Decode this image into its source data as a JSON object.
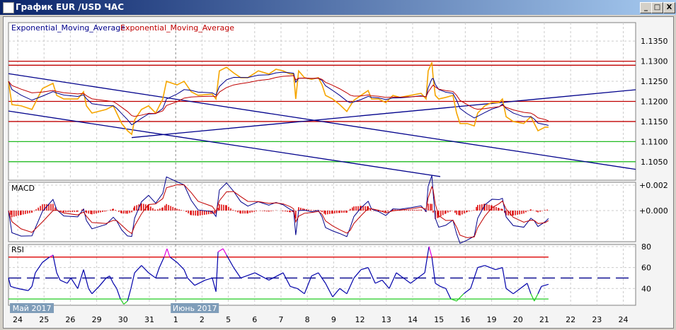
{
  "window": {
    "title": "График EUR /USD  ЧАС",
    "minimize": "_",
    "maximize": "□",
    "close": "X"
  },
  "legend": {
    "ema_fast": "Exponential_Moving_Average",
    "ema_slow": "Exponential_Moving_Average"
  },
  "colors": {
    "price": "#f5a500",
    "ema_fast": "#00008b",
    "ema_slow": "#c00000",
    "resistance": "#c00000",
    "support": "#22bb22",
    "trend": "#00008b",
    "macd_hist": "#dd0000",
    "rsi": "#0000aa",
    "rsi_over": "#dd00dd",
    "rsi_under": "#22cc22"
  },
  "chart_data": [
    {
      "type": "line",
      "panel": "price",
      "y_ticks": [
        "1.1350",
        "1.1300",
        "1.1250",
        "1.1200",
        "1.1150",
        "1.1100",
        "1.1050"
      ],
      "ylim": [
        1.1004,
        1.1396
      ],
      "x_ticks": [
        "24",
        "25",
        "26",
        "29",
        "30",
        "31",
        "1",
        "2",
        "5",
        "6",
        "7",
        "8",
        "9",
        "12",
        "13",
        "14",
        "15",
        "16",
        "19",
        "20",
        "21",
        "22",
        "23",
        "24"
      ],
      "month_labels": [
        {
          "label": "Май 2017",
          "tick": 0
        },
        {
          "label": "Июнь 2017",
          "tick": 6
        }
      ],
      "xlim": [
        -0.35,
        23.47
      ],
      "grid": true,
      "price_series": [
        [
          -0.35,
          1.125
        ],
        [
          -0.22,
          1.1192
        ],
        [
          0.13,
          1.1189
        ],
        [
          0.54,
          1.118
        ],
        [
          0.94,
          1.1232
        ],
        [
          1.34,
          1.1245
        ],
        [
          1.48,
          1.1215
        ],
        [
          1.75,
          1.1206
        ],
        [
          2.28,
          1.1206
        ],
        [
          2.5,
          1.1224
        ],
        [
          2.61,
          1.1189
        ],
        [
          2.82,
          1.1171
        ],
        [
          3.36,
          1.118
        ],
        [
          3.63,
          1.1189
        ],
        [
          3.76,
          1.1171
        ],
        [
          3.95,
          1.1145
        ],
        [
          4.17,
          1.1127
        ],
        [
          4.33,
          1.1118
        ],
        [
          4.44,
          1.1154
        ],
        [
          4.7,
          1.118
        ],
        [
          4.97,
          1.1189
        ],
        [
          5.24,
          1.1171
        ],
        [
          5.51,
          1.1206
        ],
        [
          5.65,
          1.125
        ],
        [
          6.05,
          1.1241
        ],
        [
          6.32,
          1.125
        ],
        [
          6.59,
          1.1224
        ],
        [
          6.85,
          1.1215
        ],
        [
          7.39,
          1.1218
        ],
        [
          7.53,
          1.1206
        ],
        [
          7.66,
          1.1276
        ],
        [
          7.93,
          1.1285
        ],
        [
          8.2,
          1.1271
        ],
        [
          8.47,
          1.1259
        ],
        [
          8.74,
          1.1259
        ],
        [
          9.14,
          1.1276
        ],
        [
          9.54,
          1.1268
        ],
        [
          9.81,
          1.128
        ],
        [
          10.08,
          1.1276
        ],
        [
          10.35,
          1.1268
        ],
        [
          10.48,
          1.1268
        ],
        [
          10.56,
          1.1206
        ],
        [
          10.67,
          1.1276
        ],
        [
          10.89,
          1.1259
        ],
        [
          11.16,
          1.1255
        ],
        [
          11.42,
          1.1259
        ],
        [
          11.56,
          1.1241
        ],
        [
          11.69,
          1.1215
        ],
        [
          11.96,
          1.1206
        ],
        [
          12.23,
          1.1192
        ],
        [
          12.5,
          1.1175
        ],
        [
          12.63,
          1.1189
        ],
        [
          12.77,
          1.1203
        ],
        [
          13.04,
          1.1215
        ],
        [
          13.31,
          1.1227
        ],
        [
          13.44,
          1.1206
        ],
        [
          13.71,
          1.1206
        ],
        [
          13.98,
          1.1197
        ],
        [
          14.25,
          1.1215
        ],
        [
          14.52,
          1.121
        ],
        [
          14.92,
          1.1215
        ],
        [
          15.32,
          1.122
        ],
        [
          15.51,
          1.1206
        ],
        [
          15.59,
          1.1276
        ],
        [
          15.73,
          1.1297
        ],
        [
          15.78,
          1.1259
        ],
        [
          15.86,
          1.1215
        ],
        [
          15.99,
          1.1206
        ],
        [
          16.26,
          1.121
        ],
        [
          16.53,
          1.1215
        ],
        [
          16.67,
          1.1171
        ],
        [
          16.8,
          1.1145
        ],
        [
          17.07,
          1.1145
        ],
        [
          17.34,
          1.1139
        ],
        [
          17.47,
          1.1171
        ],
        [
          17.74,
          1.1189
        ],
        [
          18.01,
          1.1197
        ],
        [
          18.28,
          1.1197
        ],
        [
          18.41,
          1.1206
        ],
        [
          18.55,
          1.1162
        ],
        [
          18.82,
          1.115
        ],
        [
          19.22,
          1.1145
        ],
        [
          19.49,
          1.1162
        ],
        [
          19.62,
          1.1145
        ],
        [
          19.76,
          1.1127
        ],
        [
          20.03,
          1.1136
        ],
        [
          20.16,
          1.1136
        ]
      ],
      "horizontal_levels": [
        {
          "price": 1.13,
          "kind": "resistance"
        },
        {
          "price": 1.129,
          "kind": "resistance"
        },
        {
          "price": 1.12,
          "kind": "resistance"
        },
        {
          "price": 1.115,
          "kind": "resistance"
        },
        {
          "price": 1.11,
          "kind": "support"
        },
        {
          "price": 1.105,
          "kind": "support"
        }
      ],
      "trend_lines": [
        [
          [
            -0.35,
            1.1269
          ],
          [
            23.47,
            1.1031
          ]
        ],
        [
          [
            -0.35,
            1.1176
          ],
          [
            16.05,
            1.1013
          ]
        ],
        [
          [
            4.33,
            1.111
          ],
          [
            23.47,
            1.1229
          ]
        ]
      ]
    },
    {
      "type": "bar",
      "panel": "macd",
      "title": "MACD",
      "y_ticks": [
        "+0.002",
        "+0.000"
      ],
      "y_tick_values": [
        0.002,
        0.0
      ]
    },
    {
      "type": "line",
      "panel": "rsi",
      "title": "RSI",
      "y_ticks": [
        "80",
        "60",
        "40"
      ],
      "ylim": [
        24,
        82
      ],
      "levels": {
        "overbought": 70,
        "middle": 50,
        "oversold": 30
      },
      "rsi_series": [
        [
          -0.35,
          50
        ],
        [
          -0.27,
          42
        ],
        [
          0,
          40
        ],
        [
          0.4,
          38
        ],
        [
          0.54,
          42
        ],
        [
          0.67,
          55
        ],
        [
          0.94,
          65
        ],
        [
          1.21,
          70
        ],
        [
          1.34,
          72
        ],
        [
          1.48,
          55
        ],
        [
          1.61,
          48
        ],
        [
          1.88,
          45
        ],
        [
          2.02,
          50
        ],
        [
          2.28,
          40
        ],
        [
          2.5,
          58
        ],
        [
          2.69,
          40
        ],
        [
          2.82,
          35
        ],
        [
          3.09,
          42
        ],
        [
          3.36,
          50
        ],
        [
          3.49,
          52
        ],
        [
          3.63,
          45
        ],
        [
          3.76,
          40
        ],
        [
          3.9,
          30
        ],
        [
          4.03,
          25
        ],
        [
          4.17,
          28
        ],
        [
          4.3,
          40
        ],
        [
          4.44,
          55
        ],
        [
          4.7,
          62
        ],
        [
          4.97,
          55
        ],
        [
          5.24,
          50
        ],
        [
          5.38,
          60
        ],
        [
          5.56,
          70
        ],
        [
          5.67,
          78
        ],
        [
          5.78,
          70
        ],
        [
          6.05,
          65
        ],
        [
          6.32,
          58
        ],
        [
          6.45,
          50
        ],
        [
          6.72,
          43
        ],
        [
          7.12,
          48
        ],
        [
          7.39,
          50
        ],
        [
          7.53,
          37
        ],
        [
          7.61,
          75
        ],
        [
          7.8,
          78
        ],
        [
          7.93,
          72
        ],
        [
          8.2,
          60
        ],
        [
          8.47,
          50
        ],
        [
          9.01,
          55
        ],
        [
          9.54,
          48
        ],
        [
          10.08,
          55
        ],
        [
          10.35,
          42
        ],
        [
          10.62,
          40
        ],
        [
          10.89,
          35
        ],
        [
          11.16,
          52
        ],
        [
          11.42,
          55
        ],
        [
          11.69,
          45
        ],
        [
          11.96,
          32
        ],
        [
          12.23,
          40
        ],
        [
          12.5,
          35
        ],
        [
          12.77,
          50
        ],
        [
          13.04,
          58
        ],
        [
          13.31,
          60
        ],
        [
          13.58,
          45
        ],
        [
          13.84,
          48
        ],
        [
          14.11,
          40
        ],
        [
          14.38,
          55
        ],
        [
          14.65,
          50
        ],
        [
          14.92,
          45
        ],
        [
          15.19,
          50
        ],
        [
          15.46,
          55
        ],
        [
          15.62,
          80
        ],
        [
          15.73,
          70
        ],
        [
          15.86,
          45
        ],
        [
          16.05,
          42
        ],
        [
          16.26,
          40
        ],
        [
          16.45,
          30
        ],
        [
          16.67,
          28
        ],
        [
          16.94,
          35
        ],
        [
          17.2,
          40
        ],
        [
          17.47,
          60
        ],
        [
          17.74,
          62
        ],
        [
          18.15,
          58
        ],
        [
          18.41,
          60
        ],
        [
          18.55,
          40
        ],
        [
          18.82,
          35
        ],
        [
          19.09,
          40
        ],
        [
          19.35,
          45
        ],
        [
          19.49,
          35
        ],
        [
          19.62,
          28
        ],
        [
          19.76,
          35
        ],
        [
          19.89,
          42
        ],
        [
          20.16,
          44
        ]
      ]
    }
  ]
}
